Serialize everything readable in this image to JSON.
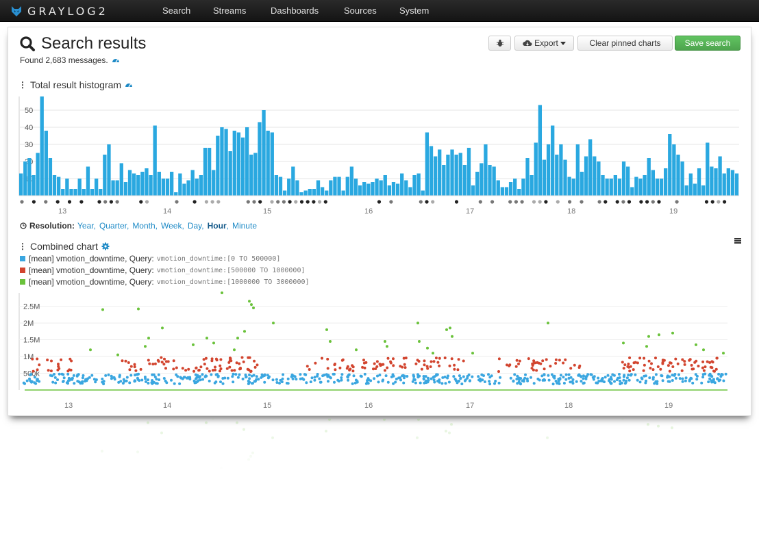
{
  "navbar": {
    "brand": "GRAYLOG2",
    "items": [
      {
        "label": "Streams"
      },
      {
        "label": "Dashboards"
      },
      {
        "label": "Sources"
      },
      {
        "label": "System"
      }
    ],
    "search_label": "Search"
  },
  "header": {
    "title": "Search results",
    "found": "Found 2,683 messages."
  },
  "toolbar": {
    "export_label": "Export",
    "clear_label": "Clear pinned charts",
    "save_label": "Save search",
    "save_color": "#5bb75b"
  },
  "histogram": {
    "title": "Total result histogram"
  },
  "resolution": {
    "label": "Resolution:",
    "options": [
      "Year",
      "Quarter",
      "Month",
      "Week",
      "Day",
      "Hour",
      "Minute"
    ],
    "active": "Hour"
  },
  "combined": {
    "title": "Combined chart",
    "legend": [
      {
        "prefix": "[mean] vmotion_downtime, Query:",
        "query": "vmotion_downtime:[0 TO 500000]",
        "color": "#3aa6e0"
      },
      {
        "prefix": "[mean] vmotion_downtime, Query:",
        "query": "vmotion_downtime:[500000 TO 1000000]",
        "color": "#d2452f"
      },
      {
        "prefix": "[mean] vmotion_downtime, Query:",
        "query": "vmotion_downtime:[1000000 TO 3000000]",
        "color": "#6ac23b"
      }
    ]
  },
  "chart_data": [
    {
      "type": "bar",
      "title": "Total result histogram",
      "y_ticks": [
        10,
        20,
        30,
        40,
        50
      ],
      "x_ticks": [
        "13",
        "14",
        "15",
        "16",
        "17",
        "18",
        "19"
      ],
      "ylim": [
        0,
        58
      ],
      "bar_color": "#2aa8e0",
      "values": [
        13,
        20,
        22,
        12,
        25,
        58,
        38,
        22,
        12,
        11,
        4,
        10,
        4,
        4,
        10,
        4,
        17,
        4,
        10,
        4,
        24,
        30,
        9,
        9,
        19,
        8,
        15,
        13,
        12,
        14,
        16,
        12,
        41,
        14,
        10,
        10,
        14,
        2,
        13,
        7,
        9,
        15,
        10,
        12,
        28,
        28,
        15,
        35,
        40,
        39,
        26,
        38,
        37,
        34,
        40,
        24,
        25,
        43,
        50,
        38,
        37,
        12,
        11,
        3,
        10,
        17,
        9,
        2,
        3,
        4,
        4,
        9,
        5,
        3,
        9,
        11,
        11,
        3,
        11,
        17,
        10,
        6,
        8,
        7,
        8,
        10,
        9,
        12,
        6,
        8,
        7,
        13,
        9,
        5,
        12,
        13,
        3,
        37,
        29,
        23,
        27,
        18,
        24,
        27,
        24,
        25,
        18,
        28,
        6,
        14,
        19,
        30,
        18,
        17,
        9,
        5,
        5,
        8,
        10,
        4,
        10,
        22,
        12,
        31,
        53,
        21,
        30,
        41,
        24,
        30,
        21,
        11,
        10,
        30,
        14,
        23,
        33,
        23,
        20,
        12,
        10,
        10,
        12,
        10,
        20,
        17,
        5,
        11,
        10,
        12,
        22,
        15,
        10,
        10,
        16,
        36,
        30,
        24,
        20,
        6,
        13,
        7,
        16,
        6,
        31,
        17,
        16,
        23,
        13,
        16,
        15,
        13
      ]
    },
    {
      "type": "scatter",
      "title": "Combined chart",
      "y_ticks": [
        "500k",
        "1M",
        "1.5M",
        "2M",
        "2.5M"
      ],
      "x_ticks": [
        "13",
        "14",
        "15",
        "16",
        "17",
        "18",
        "19"
      ],
      "ylim": [
        0,
        2900000
      ],
      "series": [
        {
          "name": "[mean] vmotion_downtime, Query: vmotion_downtime:[0 TO 500000]",
          "color": "#3aa6e0"
        },
        {
          "name": "[mean] vmotion_downtime, Query: vmotion_downtime:[500000 TO 1000000]",
          "color": "#d2452f"
        },
        {
          "name": "[mean] vmotion_downtime, Query: vmotion_downtime:[1000000 TO 3000000]",
          "color": "#6ac23b"
        }
      ]
    }
  ]
}
